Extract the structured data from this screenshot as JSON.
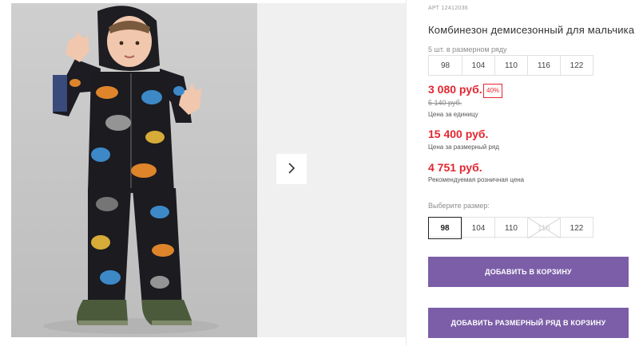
{
  "gallery": {
    "next_icon": "chevron-right-icon"
  },
  "product": {
    "article_label": "АРТ",
    "article_number": "12412036",
    "title": "Комбинезон демисезонный для мальчика",
    "series_label": "5 шт. в размерном ряду",
    "series_sizes": [
      "98",
      "104",
      "110",
      "116",
      "122"
    ]
  },
  "pricing": {
    "price": "3 080 руб.",
    "discount": "40%",
    "old_price": "5 140 руб.",
    "price_note": "Цена за единицу",
    "series_price": "15 400 руб.",
    "series_note": "Цена за размерный ряд",
    "rrp": "4 751 руб.",
    "rrp_note": "Рекомендуемая розничная цена"
  },
  "size_picker": {
    "label": "Выберите размер:",
    "sizes": [
      "98",
      "104",
      "110",
      "116",
      "122"
    ],
    "selected": "98",
    "unavailable": "116"
  },
  "actions": {
    "add_to_cart": "ДОБАВИТЬ В КОРЗИНУ",
    "add_series_to_cart": "ДОБАВИТЬ РАЗМЕРНЫЙ РЯД В КОРЗИНУ"
  },
  "colors": {
    "accent_price": "#e3262f",
    "button": "#7b5ea7"
  }
}
